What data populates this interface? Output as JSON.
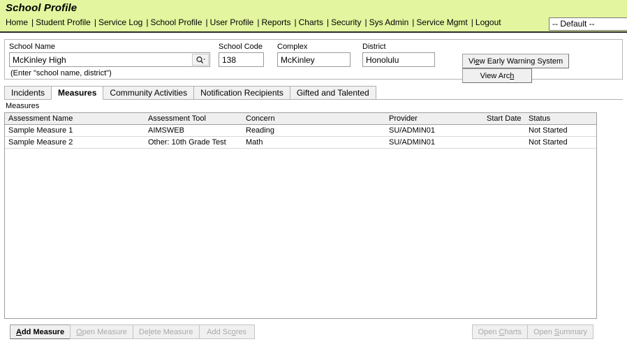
{
  "header": {
    "app_title": "School Profile",
    "nav_items": [
      "Home",
      "Student Profile",
      "Service Log",
      "School Profile",
      "User Profile",
      "Reports",
      "Charts",
      "Security",
      "Sys Admin",
      "Service Mgmt",
      "Logout"
    ],
    "nav_separator": "|",
    "profile_select_value": "-- Default --",
    "band_color": "#e3f59f"
  },
  "search_panel": {
    "school_name_label": "School Name",
    "school_name_value": "McKinley High",
    "school_name_hint": "(Enter \"school name, district\")",
    "search_icon": "magnifier-dropdown-icon",
    "school_code_label": "School Code",
    "school_code_value": "138",
    "complex_label": "Complex",
    "complex_value": "McKinley",
    "district_label": "District",
    "district_value": "Honolulu",
    "buttons": [
      {
        "label_pre": "Vi",
        "label_key": "e",
        "label_post": "w Early Warning System",
        "name": "view-early-warning-system-button",
        "disabled": false
      },
      {
        "label_pre": "View Arc",
        "label_key": "h",
        "label_post": "",
        "name": "view-archive-button",
        "disabled": false
      }
    ]
  },
  "tabs": [
    {
      "label": "Incidents",
      "active": false
    },
    {
      "label": "Measures",
      "active": true
    },
    {
      "label": "Community Activities",
      "active": false
    },
    {
      "label": "Notification Recipients",
      "active": false
    },
    {
      "label": "Gifted and Talented",
      "active": false
    }
  ],
  "grid": {
    "section_label": "Measures",
    "columns": [
      "Assessment Name",
      "Assessment Tool",
      "Concern",
      "Provider",
      "Start Date",
      "Status"
    ],
    "rows": [
      {
        "assessment_name": "Sample Measure 1",
        "assessment_tool": "AIMSWEB",
        "concern": "Reading",
        "provider": "SU/ADMIN01",
        "start_date": "",
        "status": "Not Started"
      },
      {
        "assessment_name": "Sample Measure 2",
        "assessment_tool": "Other: 10th Grade Test",
        "concern": "Math",
        "provider": "SU/ADMIN01",
        "start_date": "",
        "status": "Not Started"
      }
    ]
  },
  "footer": {
    "left_buttons": [
      {
        "label_pre": "",
        "label_key": "A",
        "label_post": "dd Measure",
        "name": "add-measure-button",
        "disabled": false,
        "strong": true
      },
      {
        "label_pre": "",
        "label_key": "O",
        "label_post": "pen Measure",
        "name": "open-measure-button",
        "disabled": true,
        "strong": false
      },
      {
        "label_pre": "De",
        "label_key": "l",
        "label_post": "ete Measure",
        "name": "delete-measure-button",
        "disabled": true,
        "strong": false
      },
      {
        "label_pre": "Add Sc",
        "label_key": "o",
        "label_post": "res",
        "name": "add-scores-button",
        "disabled": true,
        "strong": false
      }
    ],
    "right_buttons": [
      {
        "label_pre": "Open ",
        "label_key": "C",
        "label_post": "harts",
        "name": "open-charts-button",
        "disabled": true,
        "strong": false
      },
      {
        "label_pre": "Open ",
        "label_key": "S",
        "label_post": "ummary",
        "name": "open-summary-button",
        "disabled": true,
        "strong": false
      }
    ]
  }
}
